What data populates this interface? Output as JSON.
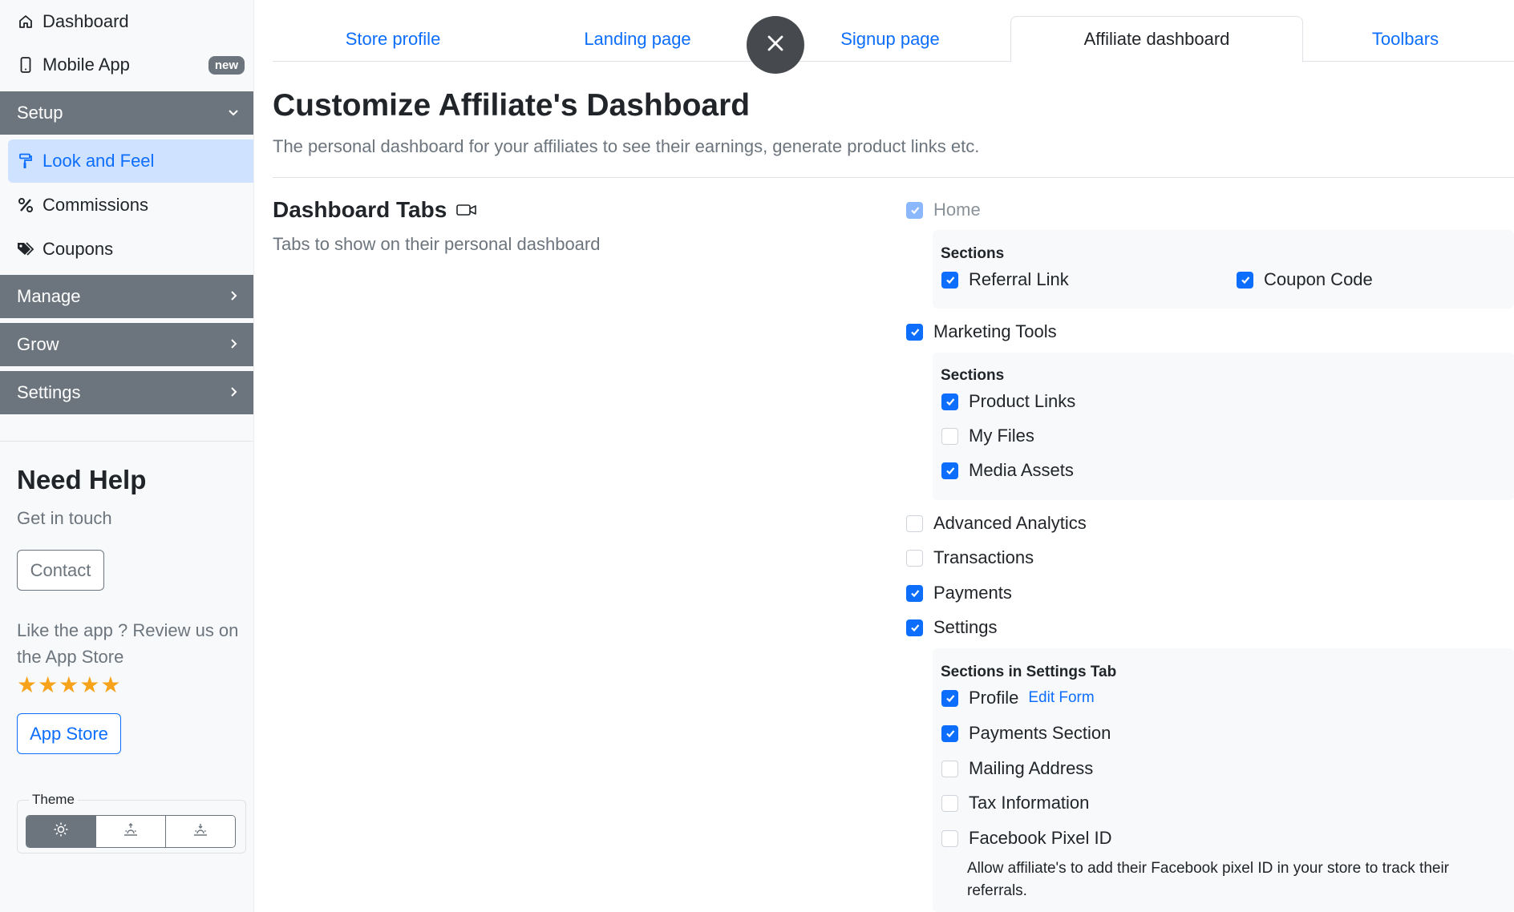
{
  "sidebar": {
    "dashboard": "Dashboard",
    "mobile_app": "Mobile App",
    "mobile_app_badge": "new",
    "setup": "Setup",
    "setup_items": [
      "Look and Feel",
      "Commissions",
      "Coupons"
    ],
    "manage": "Manage",
    "grow": "Grow",
    "settings": "Settings",
    "help_title": "Need Help",
    "help_sub": "Get in touch",
    "contact_button": "Contact",
    "review_text": "Like the app ? Review us on the App Store",
    "stars": "★★★★★",
    "rating": 5,
    "appstore_button": "App Store",
    "theme_label": "Theme",
    "theme_options": [
      "sun-icon",
      "sunrise-icon",
      "sunset-icon"
    ],
    "theme_selected": "sun-icon"
  },
  "tabs": [
    "Store profile",
    "Landing page",
    "Signup page",
    "Affiliate dashboard",
    "Toolbars"
  ],
  "active_tab": "Affiliate dashboard",
  "main": {
    "title": "Customize Affiliate's Dashboard",
    "description": "The personal dashboard for your affiliates to see their earnings, generate product links etc.",
    "section_title": "Dashboard Tabs",
    "section_desc": "Tabs to show on their personal dashboard"
  },
  "dashboard_tabs": {
    "home": {
      "label": "Home",
      "checked": true,
      "disabled": true
    },
    "home_sections_label": "Sections",
    "referral_link": {
      "label": "Referral Link",
      "checked": true
    },
    "coupon_code": {
      "label": "Coupon Code",
      "checked": true
    },
    "marketing_tools": {
      "label": "Marketing Tools",
      "checked": true
    },
    "marketing_sections_label": "Sections",
    "product_links": {
      "label": "Product Links",
      "checked": true
    },
    "my_files": {
      "label": "My Files",
      "checked": false
    },
    "media_assets": {
      "label": "Media Assets",
      "checked": true
    },
    "advanced_analytics": {
      "label": "Advanced Analytics",
      "checked": false
    },
    "transactions": {
      "label": "Transactions",
      "checked": false
    },
    "payments": {
      "label": "Payments",
      "checked": true
    },
    "settings": {
      "label": "Settings",
      "checked": true
    },
    "settings_sections_label": "Sections in Settings Tab",
    "profile": {
      "label": "Profile",
      "checked": true,
      "edit_link": "Edit Form"
    },
    "payments_section": {
      "label": "Payments Section",
      "checked": true
    },
    "mailing_address": {
      "label": "Mailing Address",
      "checked": false
    },
    "tax_information": {
      "label": "Tax Information",
      "checked": false
    },
    "facebook_pixel": {
      "label": "Facebook Pixel ID",
      "checked": false
    },
    "facebook_pixel_note": "Allow affiliate's to add their Facebook pixel ID in your store to track their referrals."
  },
  "colors": {
    "primary": "#0d6efd",
    "sidebar_section": "#6c757d",
    "active_item_bg": "#cfe2ff",
    "close_button": "#464a4f",
    "star": "#f7a21b"
  }
}
